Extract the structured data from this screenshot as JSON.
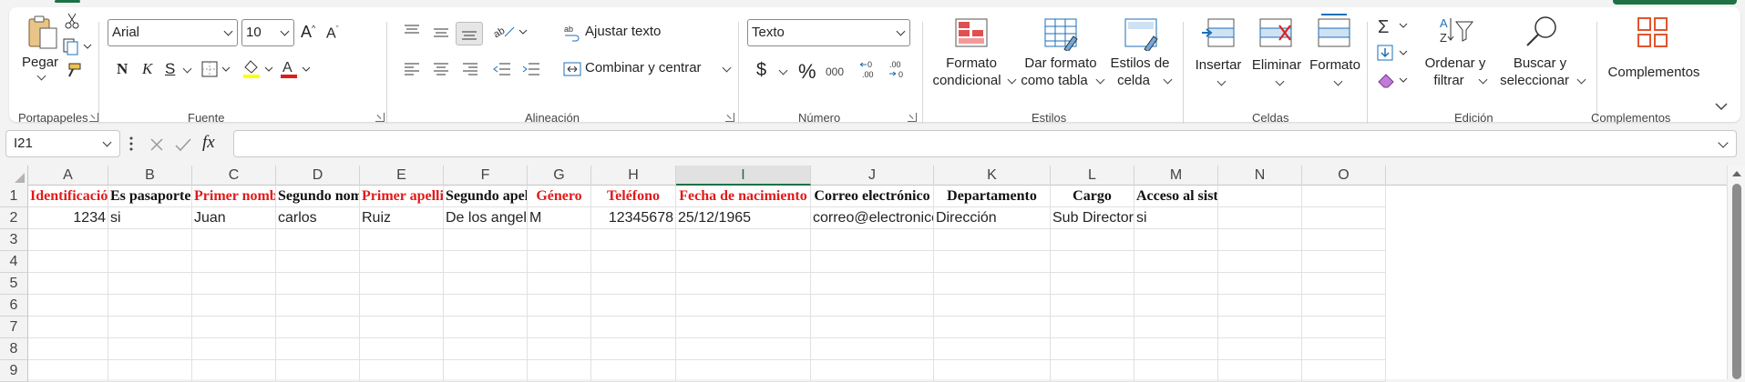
{
  "ribbon": {
    "groups": {
      "portapapeles": "Portapapeles",
      "fuente": "Fuente",
      "alineacion": "Alineación",
      "numero": "Número",
      "estilos": "Estilos",
      "celdas": "Celdas",
      "edicion": "Edición",
      "complementos": "Complementos"
    },
    "clipboard": {
      "paste": "Pegar"
    },
    "font": {
      "name": "Arial",
      "size": "10",
      "bold": "N",
      "italic": "K",
      "underline": "S"
    },
    "alignment": {
      "wrap_text": "Ajustar texto",
      "merge_center": "Combinar y centrar"
    },
    "number": {
      "format": "Texto",
      "currency": "$",
      "percent": "%",
      "thousands": "000",
      "inc_decimal": "←0\n.00",
      "dec_decimal": ".00\n→0"
    },
    "styles": {
      "conditional_1": "Formato",
      "conditional_2": "condicional",
      "table_1": "Dar formato",
      "table_2": "como tabla",
      "cell_styles_1": "Estilos de",
      "cell_styles_2": "celda"
    },
    "cells": {
      "insert": "Insertar",
      "delete": "Eliminar",
      "format": "Formato"
    },
    "editing": {
      "sort_1": "Ordenar y",
      "sort_2": "filtrar",
      "find_1": "Buscar y",
      "find_2": "seleccionar"
    },
    "addins": {
      "label": "Complementos"
    }
  },
  "formula_bar": {
    "name_box": "I21",
    "fx": "fx",
    "formula": ""
  },
  "columns": [
    "A",
    "B",
    "C",
    "D",
    "E",
    "F",
    "G",
    "H",
    "I",
    "J",
    "K",
    "L",
    "M",
    "N",
    "O"
  ],
  "selected_column": "I",
  "rows": [
    "1",
    "2",
    "3",
    "4",
    "5",
    "6",
    "7",
    "8",
    "9"
  ],
  "headers": [
    {
      "col": "A",
      "text": "Identificación",
      "color": "red"
    },
    {
      "col": "B",
      "text": "Es pasaporte",
      "color": "black"
    },
    {
      "col": "C",
      "text": "Primer nombre",
      "color": "red"
    },
    {
      "col": "D",
      "text": "Segundo nombre",
      "color": "black"
    },
    {
      "col": "E",
      "text": "Primer apellido",
      "color": "red"
    },
    {
      "col": "F",
      "text": "Segundo apellido",
      "color": "black"
    },
    {
      "col": "G",
      "text": "Género",
      "color": "red"
    },
    {
      "col": "H",
      "text": "Teléfono",
      "color": "red"
    },
    {
      "col": "I",
      "text": "Fecha de nacimiento",
      "color": "red"
    },
    {
      "col": "J",
      "text": "Correo electrónico",
      "color": "black"
    },
    {
      "col": "K",
      "text": "Departamento",
      "color": "black"
    },
    {
      "col": "L",
      "text": "Cargo",
      "color": "black"
    },
    {
      "col": "M",
      "text": "Acceso al sistema",
      "color": "black"
    }
  ],
  "row2": {
    "A": "1234",
    "B": "si",
    "C": "Juan",
    "D": "carlos",
    "E": "Ruiz",
    "F": "De los angeles",
    "G": "M",
    "H": "12345678",
    "I": "25/12/1965",
    "J": "correo@electronico.com",
    "K": "Dirección",
    "L": "Sub Director",
    "M": "si"
  },
  "colors": {
    "red_header": "#e21a1a",
    "accent_green": "#1e7145"
  }
}
